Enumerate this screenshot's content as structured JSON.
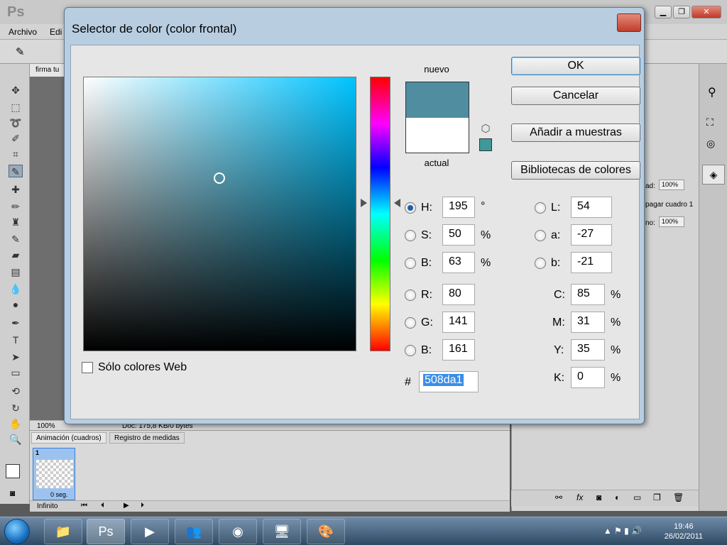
{
  "ps": {
    "logo": "Ps",
    "menu": [
      "Archivo",
      "Edi"
    ],
    "doc_tab": "firma tu",
    "zoom": "100%",
    "doc_status": "Doc: 175,8 KB/0 bytes",
    "anim_tabs": [
      "Animación (cuadros)",
      "Registro de medidas"
    ],
    "frame_number": "1",
    "frame_delay": "0 seg.",
    "loop": "Infinito",
    "layers": {
      "opacity_label": "ad:",
      "opacity_value": "100%",
      "propagate": "pagar cuadro 1",
      "fill_label": "no:",
      "fill_value": "100%"
    }
  },
  "dialog": {
    "title": "Selector de color (color frontal)",
    "nuevo_label": "nuevo",
    "actual_label": "actual",
    "new_color": "#508da1",
    "current_color": "#ffffff",
    "web_swatch_color": "#409999",
    "buttons": {
      "ok": "OK",
      "cancel": "Cancelar",
      "add_swatches": "Añadir a muestras",
      "libraries": "Bibliotecas de colores"
    },
    "web_only_label": "Sólo colores Web",
    "hsb": {
      "h": "195",
      "s": "50",
      "b": "63",
      "h_unit": "°",
      "pct": "%"
    },
    "rgb": {
      "r": "80",
      "g": "141",
      "b": "161"
    },
    "lab": {
      "l": "54",
      "a": "-27",
      "b": "-21"
    },
    "cmyk": {
      "c": "85",
      "m": "31",
      "y": "35",
      "k": "0"
    },
    "labels": {
      "h": "H:",
      "s": "S:",
      "b": "B:",
      "r": "R:",
      "g": "G:",
      "bb": "B:",
      "l": "L:",
      "a": "a:",
      "lb": "b:",
      "c": "C:",
      "m": "M:",
      "y": "Y:",
      "k": "K:"
    },
    "hex_hash": "#",
    "hex": "508da1"
  },
  "taskbar": {
    "time": "19:46",
    "date": "26/02/2011"
  }
}
